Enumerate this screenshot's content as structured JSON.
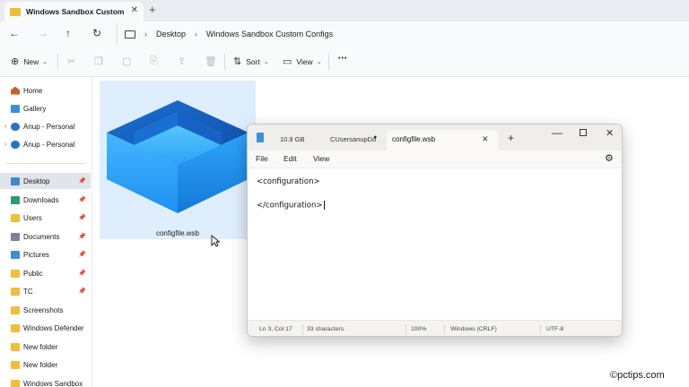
{
  "explorer": {
    "tab_title": "Windows Sandbox Custom Co",
    "breadcrumb": [
      "Desktop",
      "Windows Sandbox Custom Configs"
    ],
    "commands": {
      "new_label": "New",
      "sort_label": "Sort",
      "view_label": "View",
      "more_label": "•••"
    },
    "sidebar": {
      "top_items": [
        {
          "label": "Home",
          "icon": "home-icon"
        },
        {
          "label": "Gallery",
          "icon": "gallery-icon"
        },
        {
          "label": "Anup - Personal",
          "icon": "onedrive-icon"
        },
        {
          "label": "Anup - Personal",
          "icon": "onedrive-icon"
        }
      ],
      "quick_access": [
        {
          "label": "Desktop",
          "icon": "desktop-icon",
          "selected": true,
          "pinned": true
        },
        {
          "label": "Downloads",
          "icon": "download-icon",
          "pinned": true
        },
        {
          "label": "Users",
          "icon": "folder-icon",
          "pinned": true
        },
        {
          "label": "Documents",
          "icon": "documents-icon",
          "pinned": true
        },
        {
          "label": "Pictures",
          "icon": "pictures-icon",
          "pinned": true
        },
        {
          "label": "Public",
          "icon": "folder-icon",
          "pinned": true
        },
        {
          "label": "TC",
          "icon": "folder-icon",
          "pinned": true
        },
        {
          "label": "Screenshots",
          "icon": "folder-icon",
          "pinned": false
        },
        {
          "label": "Windows Defender",
          "icon": "folder-icon",
          "pinned": false
        },
        {
          "label": "New folder",
          "icon": "folder-icon",
          "pinned": false
        },
        {
          "label": "New folder",
          "icon": "folder-icon",
          "pinned": false
        },
        {
          "label": "Windows Sandbox",
          "icon": "folder-icon",
          "pinned": false
        }
      ]
    },
    "file": {
      "name": "configfile.wsb",
      "icon": "windows-sandbox-file-icon"
    }
  },
  "notepad": {
    "tabs": [
      "10.9 GB",
      "CUsersanupDo",
      "configfile.wsb"
    ],
    "menu": [
      "File",
      "Edit",
      "View"
    ],
    "content_lines": [
      "<configuration>",
      "</configuration>"
    ],
    "status": {
      "position": "Ln 3, Col 17",
      "characters": "33 characters",
      "zoom": "100%",
      "line_endings": "Windows (CRLF)",
      "encoding": "UTF-8"
    }
  },
  "watermark": "©pctips.com",
  "colors": {
    "accent": "#0067c0",
    "folder": "#f2bd3a",
    "selection": "#dfeefd",
    "sandbox_blue": "#1a8ff0"
  }
}
